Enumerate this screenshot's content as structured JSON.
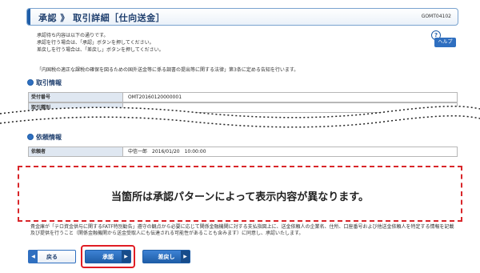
{
  "header": {
    "title": "承認 》 取引詳細［仕向送金］",
    "screen_code": "GOMT04102"
  },
  "intro": {
    "lines": [
      "承認待ち内容は以下の通りです。",
      "承認を行う場合は、「承認」ボタンを押してください。",
      "差戻しを行う場合は、「差戻し」ボタンを押してください。"
    ]
  },
  "help": {
    "label": "ヘルプ",
    "icon": "question-mark-icon"
  },
  "notice": "「内国税の適正な課税の確保を図るための国外送金等に係る調書の提出等に関する法律」第3条に定める告知を行います。",
  "sections": {
    "transaction_info": {
      "title": "取引情報",
      "rows": [
        {
          "label": "受付番号",
          "value": "OMT20160120000001"
        },
        {
          "label": "取引種別",
          "value": ""
        }
      ]
    },
    "requester_info": {
      "title": "依頼情報",
      "rows": [
        {
          "label": "依頼者",
          "value": "中信一郎　2016/01/20　10:00:00"
        }
      ]
    }
  },
  "placeholder_notice": "当箇所は承認パターンによって表示内容が異なります。",
  "disclaimer": "貴金庫が「テロ資金供与に関するFATF特別勧告」遵守の観点から必要に応じて関係金融機関に対する支払指図上に、送金依頼人の企業名、住所、口座番号および他送金依頼人を特定する情報を記載及び提供を行うこと（関係金融機関から送金受取人にも伝達される可能性があることも含みます）に同意し、承認いたします。",
  "buttons": {
    "back": "戻る",
    "approve": "承認",
    "return": "差戻し"
  },
  "colors": {
    "accent": "#1f5ea8",
    "highlight": "#e01d24"
  }
}
